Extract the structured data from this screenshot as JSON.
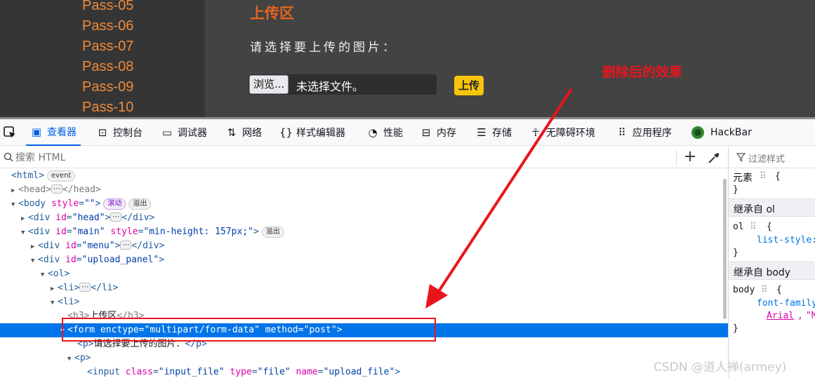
{
  "page": {
    "menu_items": [
      "Pass-05",
      "Pass-06",
      "Pass-07",
      "Pass-08",
      "Pass-09",
      "Pass-10"
    ],
    "upload_title": "上传区",
    "upload_prompt": "请选择要上传的图片：",
    "browse_label": "浏览...",
    "file_status": "未选择文件。",
    "upload_label": "上传"
  },
  "annotation": {
    "text": "删除后的效果",
    "color": "#e8161c"
  },
  "toolbar": {
    "tabs": [
      {
        "label": "查看器",
        "icon": "inspector-icon"
      },
      {
        "label": "控制台",
        "icon": "console-icon"
      },
      {
        "label": "调试器",
        "icon": "debugger-icon"
      },
      {
        "label": "网络",
        "icon": "network-icon"
      },
      {
        "label": "样式编辑器",
        "icon": "style-editor-icon"
      },
      {
        "label": "性能",
        "icon": "performance-icon"
      },
      {
        "label": "内存",
        "icon": "memory-icon"
      },
      {
        "label": "存储",
        "icon": "storage-icon"
      },
      {
        "label": "无障碍环境",
        "icon": "accessibility-icon"
      },
      {
        "label": "应用程序",
        "icon": "application-icon"
      },
      {
        "label": "HackBar",
        "icon": "hackbar-icon"
      }
    ],
    "active_tab": "查看器"
  },
  "search": {
    "placeholder": "搜索 HTML"
  },
  "rules": {
    "filter_placeholder": "过滤样式",
    "element_label": "元素",
    "inherit_ol": "继承自 ol",
    "ol_selector": "ol",
    "ol_prop": "list-style:",
    "inherit_body": "继承自 body",
    "body_selector": "body",
    "body_prop": "font-family",
    "body_val_1": "Arial",
    "body_val_2": "\"Mi"
  },
  "tree": {
    "html": "<html>",
    "html_badge": "event",
    "head_open": "<head>",
    "head_close": "</head>",
    "body_tag": "<body",
    "body_attr": "style",
    "body_val": "\"\"",
    "badge_scroll": "滚动",
    "badge_overflow": "溢出",
    "div_head_tag": "<div",
    "div_head_attr": "id",
    "div_head_val": "\"head\"",
    "div_close": "</div>",
    "div_main_val": "\"main\"",
    "div_main_style_attr": "style",
    "div_main_style_val": "\"min-height: 157px;\"",
    "div_menu_val": "\"menu\"",
    "div_upload_val": "\"upload_panel\"",
    "ol_open": "<ol>",
    "li_open": "<li>",
    "li_close": "</li>",
    "h3_open": "<h3>",
    "h3_text": "上传区",
    "h3_close": "</h3>",
    "form_tag": "<form",
    "form_attr1": "enctype",
    "form_val1": "\"multipart/form-data\"",
    "form_attr2": "method",
    "form_val2": "\"post\"",
    "p_open": "<p>",
    "p_text": "请选择要上传的图片：",
    "p_close": "</p>",
    "input_tag": "<input",
    "input_attr1": "class",
    "input_val1": "\"input_file\"",
    "input_attr2": "type",
    "input_val2": "\"file\"",
    "input_attr3": "name",
    "input_val3": "\"upload_file\"",
    "gt": ">",
    "ell": "⋯"
  },
  "watermark": "CSDN @道人禅(armey)"
}
